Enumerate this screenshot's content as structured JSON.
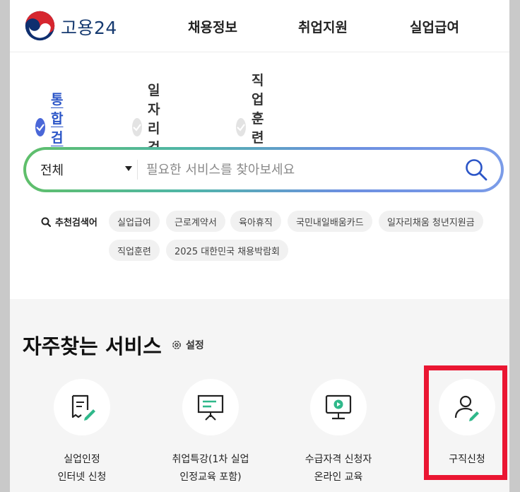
{
  "header": {
    "brand": "고용24",
    "nav": [
      "채용정보",
      "취업지원",
      "실업급여"
    ]
  },
  "search": {
    "tabs": [
      {
        "label": "통합검색",
        "active": true
      },
      {
        "label": "일자리 검색",
        "active": false
      },
      {
        "label": "직업훈련 검색",
        "active": false
      }
    ],
    "category": "전체",
    "placeholder": "필요한 서비스를 찾아보세요",
    "recommended_label": "추천검색어",
    "recommended": [
      "실업급여",
      "근로계약서",
      "육아휴직",
      "국민내일배움카드",
      "일자리채움 청년지원금",
      "직업훈련",
      "2025 대한민국 채용박람회"
    ]
  },
  "services": {
    "title": "자주찾는 서비스",
    "settings_label": "설정",
    "items": [
      {
        "label": "실업인정\n인터넷 신청",
        "icon": "certificate-edit-icon"
      },
      {
        "label": "취업특강(1차 실업\n인정교육 포함)",
        "icon": "presentation-board-icon"
      },
      {
        "label": "수급자격 신청자\n온라인 교육",
        "icon": "monitor-play-icon"
      },
      {
        "label": "구직신청",
        "icon": "person-edit-icon"
      }
    ]
  },
  "colors": {
    "accent_blue": "#2b55c7",
    "accent_green": "#2fb88a",
    "highlight_red": "#ea1632"
  }
}
